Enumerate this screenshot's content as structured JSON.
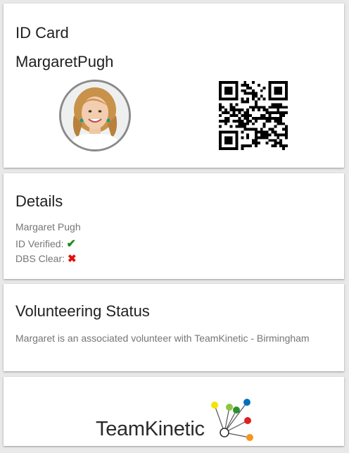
{
  "id_card": {
    "title": "ID Card",
    "holder_name": "MargaretPugh",
    "qr_icon": "qr-code-icon",
    "avatar_icon": "profile-photo"
  },
  "details": {
    "title": "Details",
    "name": "Margaret Pugh",
    "id_verified_label": "ID Verified:",
    "id_verified_icon": "checkmark-icon",
    "dbs_label": "DBS Clear:",
    "dbs_icon": "cross-icon",
    "colors": {
      "verified": "#1e8a1e",
      "not_clear": "#e01010"
    }
  },
  "volunteering": {
    "title": "Volunteering Status",
    "text": "Margaret is an associated volunteer with TeamKinetic - Birmingham"
  },
  "footer": {
    "logo_text": "TeamKinetic",
    "logo_dot_colors": [
      "#f2e400",
      "#8cc63f",
      "#2f8f2f",
      "#0071bc",
      "#e02020",
      "#f7941d"
    ]
  }
}
